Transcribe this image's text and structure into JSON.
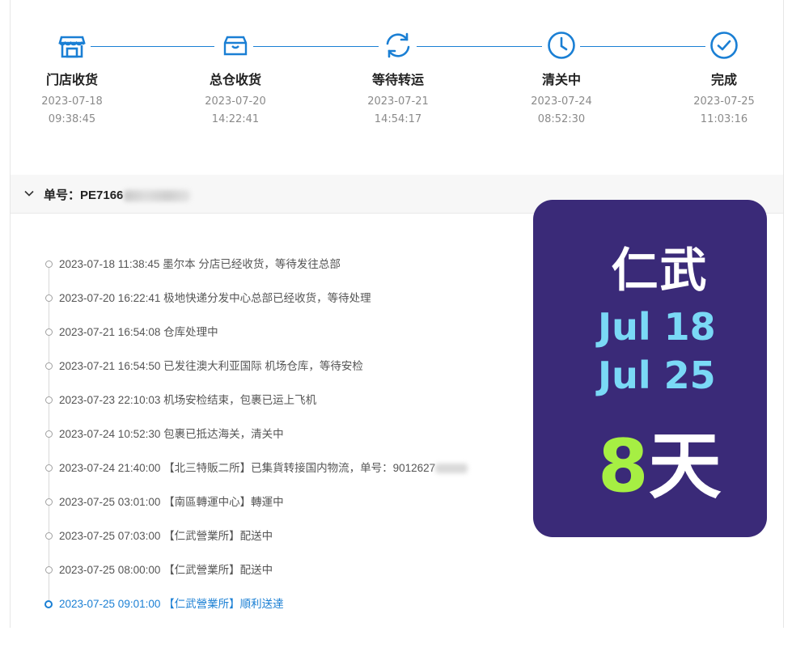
{
  "colors": {
    "accent": "#1a7fd4",
    "card_bg": "#3a2a78",
    "card_date": "#7ad9f6",
    "card_num": "#a6ef43"
  },
  "steps": [
    {
      "icon": "store-icon",
      "label": "门店收货",
      "date": "2023-07-18",
      "time": "09:38:45"
    },
    {
      "icon": "box-icon",
      "label": "总仓收货",
      "date": "2023-07-20",
      "time": "14:22:41"
    },
    {
      "icon": "refresh-icon",
      "label": "等待转运",
      "date": "2023-07-21",
      "time": "14:54:17"
    },
    {
      "icon": "clock-icon",
      "label": "清关中",
      "date": "2023-07-24",
      "time": "08:52:30"
    },
    {
      "icon": "check-circle-icon",
      "label": "完成",
      "date": "2023-07-25",
      "time": "11:03:16"
    }
  ],
  "order": {
    "title": "单号：PE7166"
  },
  "timeline": [
    {
      "text": "2023-07-18 11:38:45 墨尔本 分店已经收货，等待发往总部"
    },
    {
      "text": "2023-07-20 16:22:41 极地快递分发中心总部已经收货，等待处理"
    },
    {
      "text": "2023-07-21 16:54:08 仓库处理中"
    },
    {
      "text": "2023-07-21 16:54:50 已发往澳大利亚国际 机场仓库，等待安检"
    },
    {
      "text": "2023-07-23 22:10:03 机场安检结束，包裹已运上飞机"
    },
    {
      "text": "2023-07-24 10:52:30 包裹已抵达海关，清关中"
    },
    {
      "text": "2023-07-24 21:40:00 【北三特販二所】已集貨转接国内物流，单号：9012627"
    },
    {
      "text": "2023-07-25 03:01:00 【南區轉運中心】轉運中"
    },
    {
      "text": "2023-07-25 07:03:00 【仁武營業所】配送中"
    },
    {
      "text": "2023-07-25 08:00:00 【仁武營業所】配送中"
    },
    {
      "text": "2023-07-25 09:01:00 【仁武營業所】順利送達"
    }
  ],
  "card": {
    "place": "仁武",
    "date_start": "Jul 18",
    "date_end": "Jul 25",
    "days_num": "8",
    "days_unit": "天"
  }
}
